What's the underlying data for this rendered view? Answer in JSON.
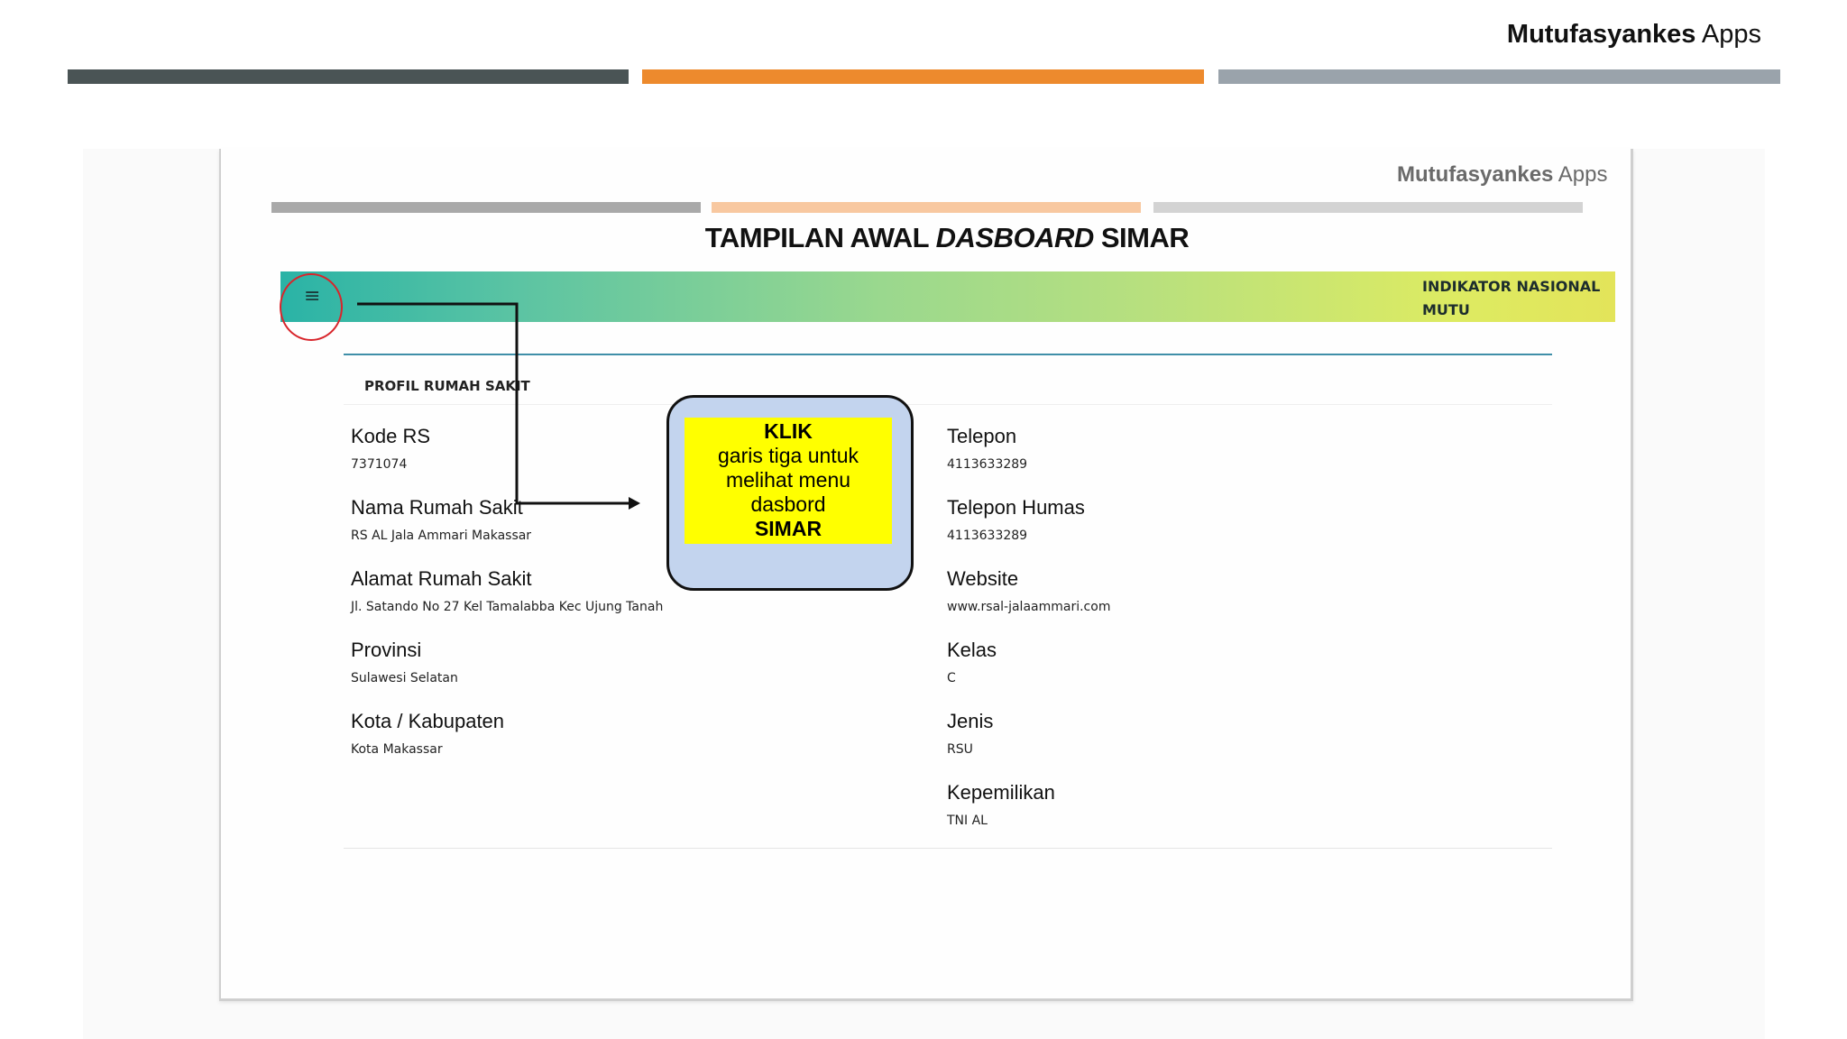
{
  "slide": {
    "brand_bold": "Mutufasyankes",
    "brand_regular": " Apps"
  },
  "inner": {
    "brand_bold": "Mutufasyankes",
    "brand_regular": " Apps",
    "title_part1": "TAMPILAN AWAL ",
    "title_italic": "DASBOARD",
    "title_part2": " SIMAR"
  },
  "app": {
    "menu_icon": "≡",
    "header_title_line1": "INDIKATOR NASIONAL",
    "header_title_line2": "MUTU"
  },
  "profile": {
    "title": "PROFIL RUMAH SAKIT",
    "left": [
      {
        "label": "Kode RS",
        "value": "7371074"
      },
      {
        "label": "Nama Rumah Sakit",
        "value": "RS AL Jala Ammari Makassar"
      },
      {
        "label": "Alamat Rumah Sakit",
        "value": "Jl. Satando No 27 Kel Tamalabba Kec Ujung Tanah"
      },
      {
        "label": "Provinsi",
        "value": "Sulawesi Selatan"
      },
      {
        "label": "Kota / Kabupaten",
        "value": "Kota Makassar"
      }
    ],
    "right": [
      {
        "label": "Telepon",
        "value": "4113633289"
      },
      {
        "label": "Telepon Humas",
        "value": "4113633289"
      },
      {
        "label": "Website",
        "value": "www.rsal-jalaammari.com"
      },
      {
        "label": "Kelas",
        "value": "C"
      },
      {
        "label": "Jenis",
        "value": "RSU"
      },
      {
        "label": "Kepemilikan",
        "value": "TNI AL"
      }
    ]
  },
  "callout": {
    "line1": "KLIK",
    "line2": "garis tiga untuk",
    "line3": "melihat menu",
    "line4": "dasbord",
    "line5": "SIMAR"
  },
  "colors": {
    "bar_dark": "#4a5455",
    "bar_orange": "#ed8a2d",
    "bar_gray": "#9aa3ab",
    "header_gradient_start": "#2ab3a6",
    "header_gradient_end": "#e3e45a",
    "callout_bg": "#c3d4ee",
    "callout_highlight": "#ffff00",
    "circle": "#d8252b"
  }
}
